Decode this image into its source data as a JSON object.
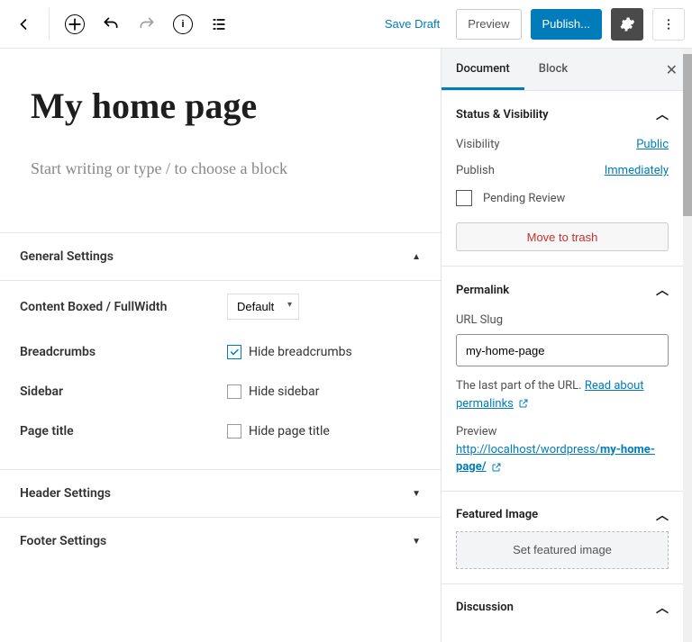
{
  "toolbar": {
    "save_draft": "Save Draft",
    "preview": "Preview",
    "publish": "Publish..."
  },
  "editor": {
    "title": "My home page",
    "placeholder": "Start writing or type / to choose a block"
  },
  "meta_panels": {
    "general": {
      "title": "General Settings",
      "content_label": "Content Boxed / FullWidth",
      "content_value": "Default",
      "breadcrumbs_label": "Breadcrumbs",
      "breadcrumbs_cb": "Hide breadcrumbs",
      "sidebar_label": "Sidebar",
      "sidebar_cb": "Hide sidebar",
      "pagetitle_label": "Page title",
      "pagetitle_cb": "Hide page title"
    },
    "header": {
      "title": "Header Settings"
    },
    "footer": {
      "title": "Footer Settings"
    }
  },
  "sidebar": {
    "tabs": {
      "document": "Document",
      "block": "Block"
    },
    "status": {
      "title": "Status & Visibility",
      "visibility_label": "Visibility",
      "visibility_value": "Public",
      "publish_label": "Publish",
      "publish_value": "Immediately",
      "pending": "Pending Review",
      "trash": "Move to trash"
    },
    "permalink": {
      "title": "Permalink",
      "slug_label": "URL Slug",
      "slug_value": "my-home-page",
      "help1": "The last part of the URL. ",
      "help_link": "Read about permalinks",
      "preview_label": "Preview",
      "preview_url_prefix": "http://localhost/wordpress/",
      "preview_url_slug": "my-home-page/"
    },
    "featured": {
      "title": "Featured Image",
      "button": "Set featured image"
    },
    "discussion": {
      "title": "Discussion"
    }
  }
}
